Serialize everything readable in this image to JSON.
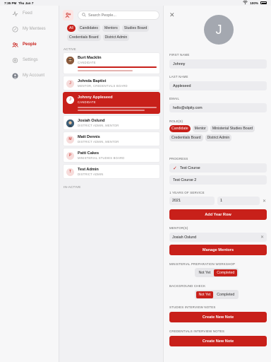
{
  "status": {
    "time": "7:35 PM",
    "date": "Thu Jan 7",
    "battery": "100%"
  },
  "nav": {
    "items": [
      {
        "label": "Feed",
        "icon": "feed-icon"
      },
      {
        "label": "My Mentees",
        "icon": "mentees-icon"
      },
      {
        "label": "People",
        "icon": "people-icon"
      },
      {
        "label": "Settings",
        "icon": "gear-icon"
      },
      {
        "label": "My Account",
        "icon": "account-icon"
      }
    ]
  },
  "list": {
    "search_placeholder": "Search People...",
    "filters": [
      "All",
      "Candidates",
      "Mentors",
      "Studies Board",
      "Credentials Board",
      "District Admin"
    ],
    "active_label": "ACTIVE",
    "inactive_label": "IN-ACTIVE",
    "people": [
      {
        "initial": "",
        "name": "Burt Macklin",
        "role": "CANDIDATE"
      },
      {
        "initial": "J",
        "name": "Johnda Baptist",
        "role": "MENTOR, CREDENTIALS BOARD"
      },
      {
        "initial": "J",
        "name": "Johnny Appleseed",
        "role": "CANDIDATE"
      },
      {
        "initial": "",
        "name": "Josiah Oslund",
        "role": "DISTRICT ADMIN, MENTOR"
      },
      {
        "initial": "M",
        "name": "Matt Dennis",
        "role": "DISTRICT ADMIN, MENTOR"
      },
      {
        "initial": "P",
        "name": "Patti Cakes",
        "role": "MINISTERIAL STUDIES BOARD"
      },
      {
        "initial": "T",
        "name": "Test Admin",
        "role": "DISTRICT ADMIN"
      }
    ]
  },
  "detail": {
    "avatar_initial": "J",
    "first_name_label": "FIRST NAME",
    "first_name": "Johnny",
    "last_name_label": "LAST NAME",
    "last_name": "Appleseed",
    "email_label": "EMAIL",
    "email": "hello@slipity.com",
    "roles_label": "ROLE(S)",
    "roles": [
      "Candidate",
      "Mentor",
      "Ministerial Studies Board",
      "Credentials Board",
      "District Admin"
    ],
    "progress_label": "PROGRESS",
    "progress": [
      "Test Course",
      "Test Course 2"
    ],
    "year_label": "1 YEARS OF SERVICE",
    "year_value": "2021",
    "year_count": "1",
    "add_year": "Add Year Row",
    "mentors_label": "MENTOR(S)",
    "mentor": "Josiah Oslund",
    "manage_mentors": "Manage Mentors",
    "workshop_label": "MINISTERIAL PREPARATION WORKSHOP",
    "workshop_options": [
      "Not Yet",
      "Completed"
    ],
    "background_label": "BACKGROUND CHECK",
    "background_options": [
      "Not Yet",
      "Completed"
    ],
    "studies_notes_label": "STUDIES INTERVIEW NOTES",
    "credentials_notes_label": "CREDENTIALS INTERVIEW NOTES",
    "create_note": "Create New Note"
  }
}
